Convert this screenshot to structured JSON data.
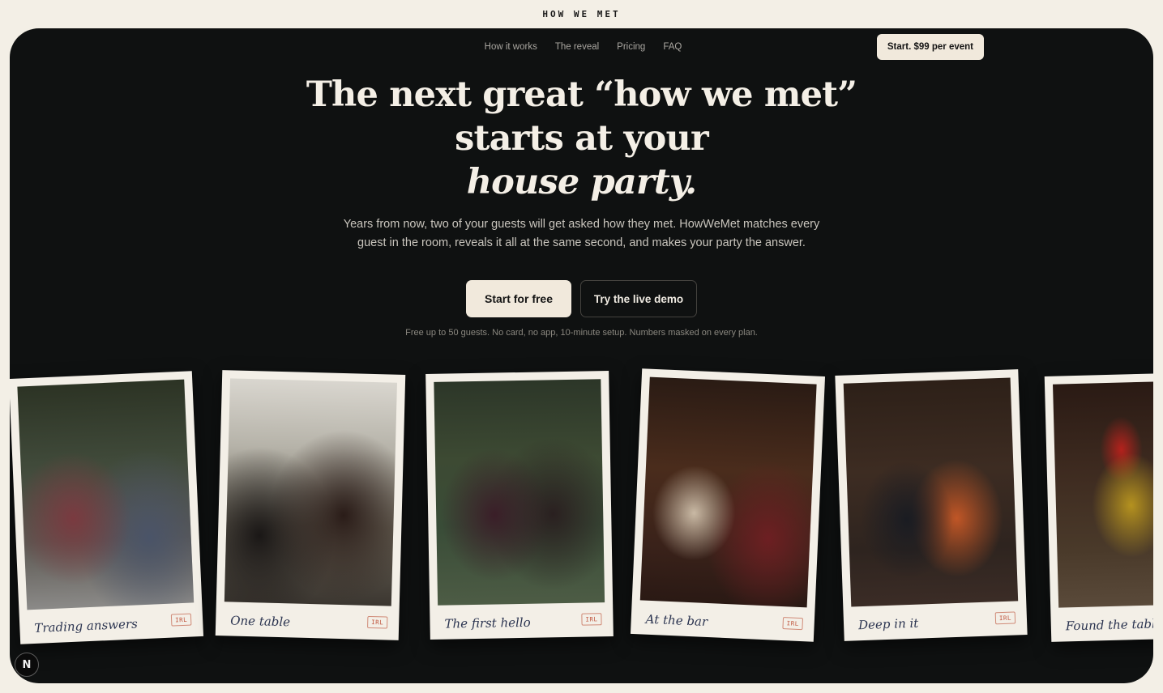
{
  "brand": "HOW WE MET",
  "nav": {
    "links": [
      "How it works",
      "The reveal",
      "Pricing",
      "FAQ"
    ],
    "cta": "Start. $99 per event"
  },
  "hero": {
    "headline_line1": "The next great “how we met”",
    "headline_line2": "starts at your",
    "headline_line3": "house party.",
    "subcopy": "Years from now, two of your guests will get asked how they met. HowWeMet matches every guest in the room, reveals it all at the same second, and makes your party the answer.",
    "primary_cta": "Start for free",
    "secondary_cta": "Try the live demo",
    "finenote": "Free up to 50 guests. No card, no app, 10-minute setup. Numbers masked on every plan."
  },
  "polaroids": [
    {
      "caption": "Trading answers",
      "tag": "IRL"
    },
    {
      "caption": "One table",
      "tag": "IRL"
    },
    {
      "caption": "The first hello",
      "tag": "IRL"
    },
    {
      "caption": "At the bar",
      "tag": "IRL"
    },
    {
      "caption": "Deep in it",
      "tag": "IRL"
    },
    {
      "caption": "Found the table",
      "tag": ""
    }
  ],
  "badge": "N"
}
